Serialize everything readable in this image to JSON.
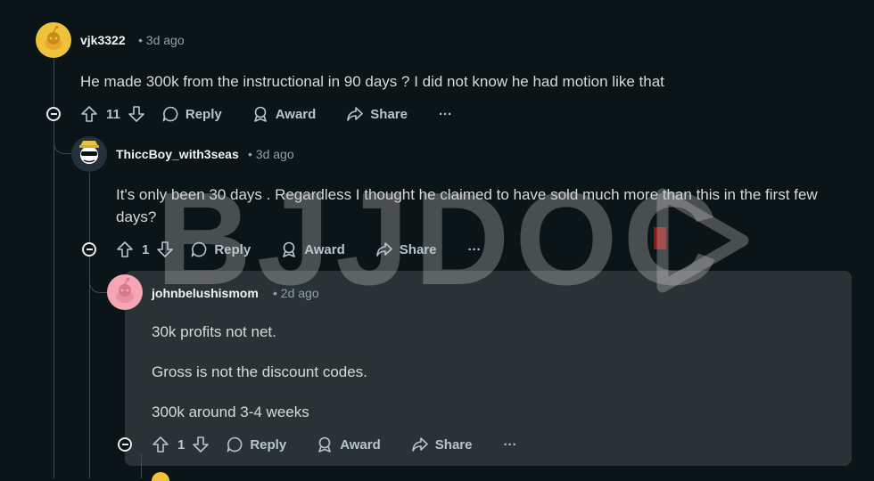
{
  "comments": [
    {
      "username": "vjk3322",
      "time": "3d ago",
      "body": [
        "He made 300k from the instructional in 90 days ? I did not know he had motion like that"
      ],
      "votes": "11",
      "avatar_color": "#f0c23b"
    },
    {
      "username": "ThiccBoy_with3seas",
      "time": "3d ago",
      "body": [
        "It's only been 30 days . Regardless I thought he claimed to have sold much more than this in the first few",
        "days?"
      ],
      "votes": "1",
      "avatar_color": "#24303a"
    },
    {
      "username": "johnbelushismom",
      "time": "2d ago",
      "body": [
        "30k profits not net.",
        "Gross is not the discount codes.",
        "300k around 3-4 weeks"
      ],
      "votes": "1",
      "avatar_color": "#f4a6b5"
    }
  ],
  "actions": {
    "reply": "Reply",
    "award": "Award",
    "share": "Share",
    "more": "···"
  },
  "meta_separator": "•",
  "watermark": "BJJDOC",
  "colors": {
    "background": "#0b1416",
    "highlight": "#2b3236",
    "text": "#d7dadc",
    "muted": "#8ba2ad"
  }
}
